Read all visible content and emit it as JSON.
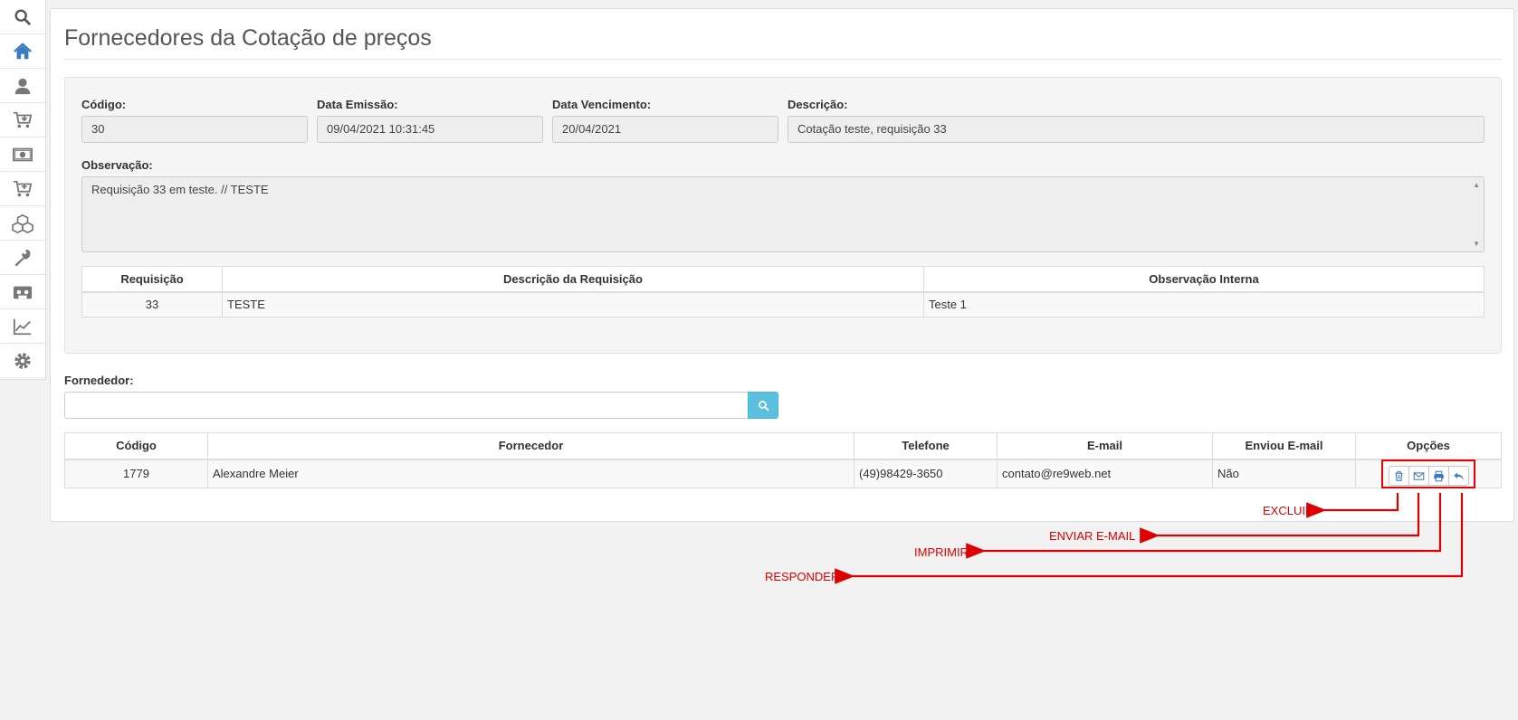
{
  "sidebar": {
    "items": [
      {
        "icon": "search-icon"
      },
      {
        "icon": "home-icon"
      },
      {
        "icon": "user-icon"
      },
      {
        "icon": "cart-download-icon"
      },
      {
        "icon": "money-icon"
      },
      {
        "icon": "cart-plus-icon"
      },
      {
        "icon": "cubes-icon"
      },
      {
        "icon": "wrench-icon"
      },
      {
        "icon": "cassette-icon"
      },
      {
        "icon": "chart-line-icon"
      },
      {
        "icon": "gear-icon"
      }
    ]
  },
  "page": {
    "title": "Fornecedores da Cotação de preços"
  },
  "form": {
    "codigo": {
      "label": "Código:",
      "value": "30"
    },
    "data_emissao": {
      "label": "Data Emissão:",
      "value": "09/04/2021 10:31:45"
    },
    "data_vencimento": {
      "label": "Data Vencimento:",
      "value": "20/04/2021"
    },
    "descricao": {
      "label": "Descrição:",
      "value": "Cotação teste, requisição 33"
    },
    "observacao": {
      "label": "Observação:",
      "value": "Requisição 33 em teste. // TESTE"
    }
  },
  "req_table": {
    "headers": [
      "Requisição",
      "Descrição da Requisição",
      "Observação Interna"
    ],
    "rows": [
      [
        "33",
        "TESTE",
        "Teste 1"
      ]
    ]
  },
  "fornecedor": {
    "label": "Fornededor:",
    "value": ""
  },
  "forn_table": {
    "headers": [
      "Código",
      "Fornecedor",
      "Telefone",
      "E-mail",
      "Enviou E-mail",
      "Opções"
    ],
    "rows": [
      [
        "1779",
        "Alexandre Meier",
        "(49)98429-3650",
        "contato@re9web.net",
        "Não"
      ]
    ]
  },
  "annotations": {
    "excluir": "EXCLUIR",
    "enviar": "ENVIAR E-MAIL",
    "imprimir": "IMPRIMIR",
    "responder": "RESPONDER"
  },
  "colors": {
    "annotation": "#dd0000",
    "primary_icon": "#3a7ac0",
    "search_btn": "#5bc0de"
  }
}
